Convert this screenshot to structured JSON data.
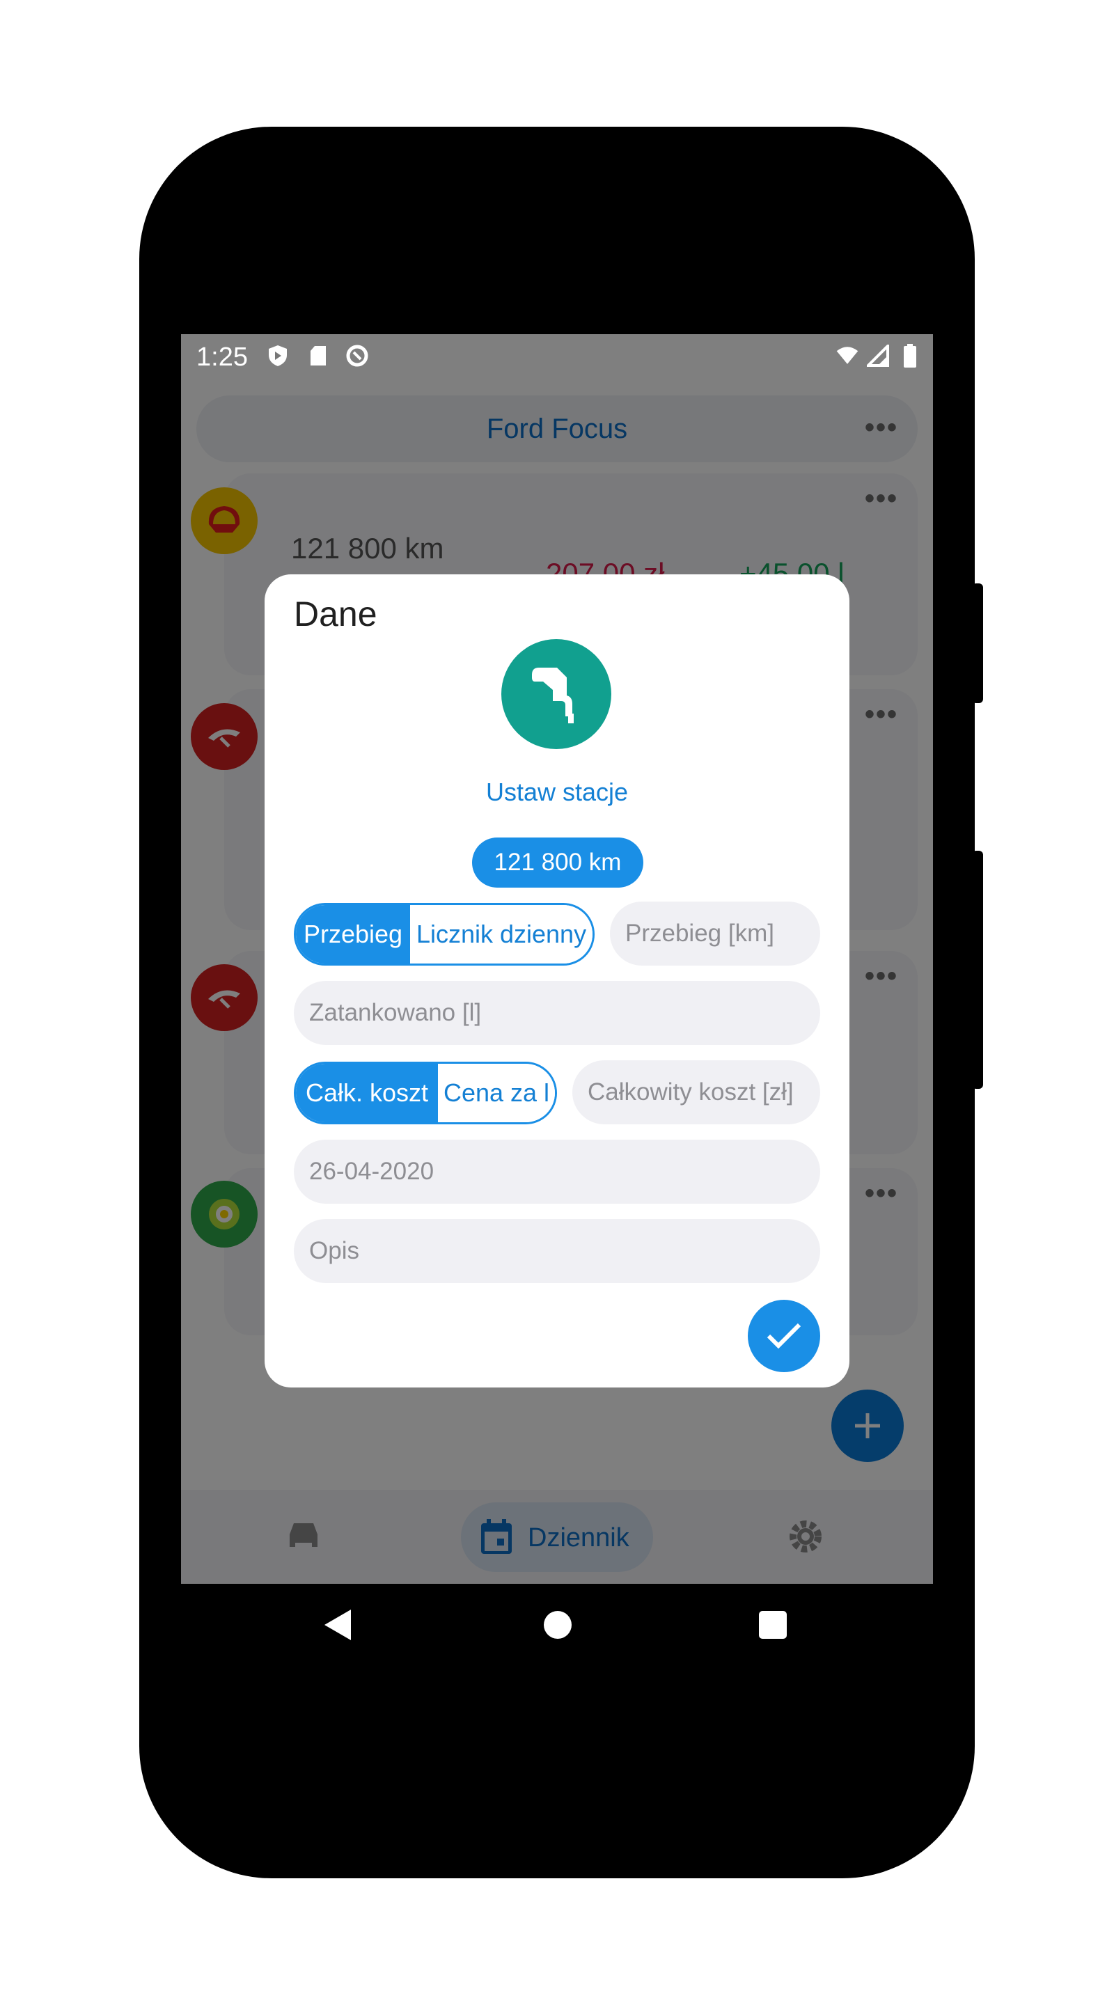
{
  "status_bar": {
    "time": "1:25"
  },
  "topbar": {
    "title": "Ford Focus",
    "more": "•••"
  },
  "entries": [
    {
      "logo": "shell-logo",
      "odometer": "121 800 km",
      "cost": "207,00 zł",
      "volume": "+45,00 l",
      "more": "•••"
    },
    {
      "logo": "orlen-logo",
      "more": "•••"
    },
    {
      "logo": "orlen-logo",
      "more": "•••"
    },
    {
      "logo": "bp-logo",
      "more": "•••"
    }
  ],
  "bottom_nav": {
    "active_label": "Dziennik"
  },
  "dialog": {
    "title": "Dane",
    "set_station": "Ustaw stacje",
    "km_chip": "121 800 km",
    "mileage_toggle": {
      "option1": "Przebieg",
      "option2": "Licznik dzienny"
    },
    "mileage_placeholder": "Przebieg [km]",
    "fuel_placeholder": "Zatankowano [l]",
    "cost_toggle": {
      "option1": "Całk. koszt",
      "option2": "Cena za l"
    },
    "cost_placeholder": "Całkowity koszt [zł]",
    "date_value": "26-04-2020",
    "description_placeholder": "Opis"
  },
  "colors": {
    "accent": "#1a8fe6",
    "pump": "#11a08f",
    "title_blue": "#0d6fc7"
  }
}
